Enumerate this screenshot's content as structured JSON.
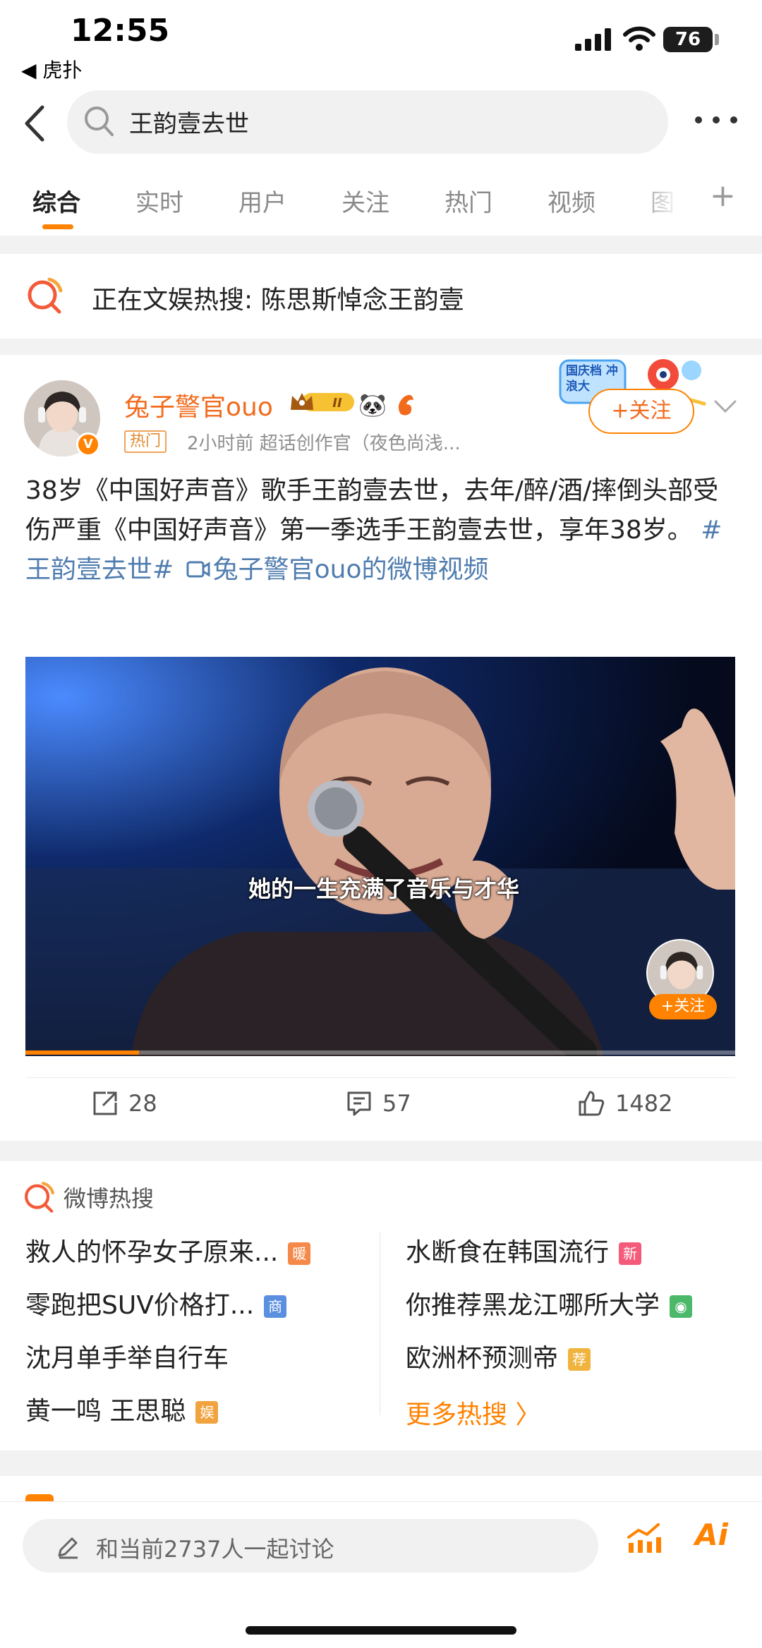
{
  "status_bar": {
    "time": "12:55",
    "back_app": "◀ 虎扑",
    "battery": "76"
  },
  "search": {
    "query": "王韵壹去世"
  },
  "tabs": [
    "综合",
    "实时",
    "用户",
    "关注",
    "热门",
    "视频",
    "图"
  ],
  "hot_notice": {
    "text": "正在文娱热搜: 陈思斯悼念王韵壹"
  },
  "post": {
    "author": "兔子警官ouo",
    "vip_level": "II",
    "hot_tag": "热门",
    "meta": "2小时前  超话创作官（夜色尚浅...",
    "follow_label": "+关注",
    "promo_text": "国庆档 冲浪大",
    "text": "38岁《中国好声音》歌手王韵壹去世，去年/醉/酒/摔倒头部受伤严重《中国好声音》第一季选手王韵壹去世，享年38岁。",
    "topic": "#王韵壹去世#",
    "video_link": "兔子警官ouo的微博视频",
    "video": {
      "subtitle": "她的一生充满了音乐与才华",
      "follow_label": "+关注",
      "progress": 0.16
    },
    "actions": {
      "reposts": "28",
      "comments": "57",
      "likes": "1482"
    }
  },
  "hot_search": {
    "title": "微博热搜",
    "left": [
      {
        "text": "救人的怀孕女子原来...",
        "badge": "暖",
        "color": "#f4894a"
      },
      {
        "text": "零跑把SUV价格打...",
        "badge": "商",
        "color": "#5b8fe0"
      },
      {
        "text": "沈月单手举自行车",
        "badge": "",
        "color": ""
      },
      {
        "text": "黄一鸣 王思聪",
        "badge": "娱",
        "color": "#f0a33e"
      }
    ],
    "right": [
      {
        "text": "水断食在韩国流行",
        "badge": "新",
        "color": "#f45a7a"
      },
      {
        "text": "你推荐黑龙江哪所大学",
        "badge": "◉",
        "color": "#4cb86a"
      },
      {
        "text": "欧洲杯预测帝",
        "badge": "荐",
        "color": "#f0b33e"
      }
    ],
    "more": "更多热搜  〉"
  },
  "comment_bar": {
    "placeholder": "和当前2737人一起讨论",
    "ai_label": "Ai"
  },
  "colors": {
    "accent": "#ff8200",
    "link": "#507daf"
  }
}
